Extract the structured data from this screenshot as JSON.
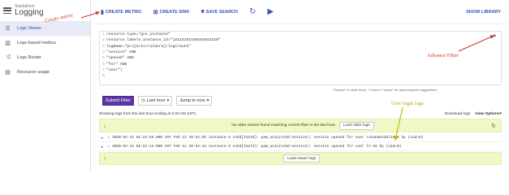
{
  "sidebar": {
    "brand_sub": "Stackdriver",
    "brand_title": "Logging",
    "items": [
      {
        "label": "Logs Viewer",
        "icon": "list-icon",
        "active": true
      },
      {
        "label": "Logs-based metrics",
        "icon": "bar-chart-icon",
        "active": false
      },
      {
        "label": "Logs Router",
        "icon": "shuffle-icon",
        "active": false
      },
      {
        "label": "Resource usage",
        "icon": "storage-icon",
        "active": false
      }
    ]
  },
  "toolbar": {
    "create_metric": "CREATE METRIC",
    "create_sink": "CREATE SINK",
    "save_search": "SAVE SEARCH",
    "show_library": "SHOW LIBRARY"
  },
  "editor": {
    "lines": [
      {
        "n": "1",
        "text": "resource.type=\"gce_instance\""
      },
      {
        "n": "2",
        "text": "resource.labels.instance_id=\"12115152168152642220\""
      },
      {
        "n": "3",
        "text": "logName=\"projects/rutanraj/logs/auth\""
      },
      {
        "n": "4",
        "text": "\"session\" AND"
      },
      {
        "n": "5",
        "text": "\"opened\" AND"
      },
      {
        "n": "6",
        "text": "\"for\" AND"
      },
      {
        "n": "7",
        "text": "\"user\"|"
      },
      {
        "n": "8",
        "text": ""
      }
    ],
    "hint": "\"Escape\" to clear focus. \"Control + Space\" for autocomplete suggestions"
  },
  "filters": {
    "submit": "Submit Filter",
    "time": "Last hour",
    "jump": "Jump to now"
  },
  "logs_header": {
    "summary": "Showing logs from the last hour ending at 2:24 AM (IST)",
    "download": "Download logs",
    "view_options": "View Options"
  },
  "older_bar": {
    "message": "No older entries found matching current filter in the last hour.",
    "button": "Load older logs"
  },
  "log_rows": [
    "2020-02-13 02:21:55.000 IST Feb 12 20:51:55 instance-3 sshd[31234]: pam_unix(sshd:session): session opened for user rutanmondal1996 by (uid=0)",
    "2020-02-13 02:22:44.000 IST Feb 12 20:52:44 instance-3 sshd[31272]: pam_unix(sshd:session): session opened for user lt-62 by (uid=0)"
  ],
  "newer_bar": {
    "button": "Load newer logs"
  },
  "annotations": {
    "create_metric": "Create metric",
    "advance_filter": "Advance Filter",
    "user_login": "User login logs"
  },
  "colors": {
    "accent": "#3f51b5",
    "submit": "#5c35a6",
    "green_bar": "#f0f9c6",
    "annotation_red": "#d32f2f",
    "annotation_yellow": "#b8a600"
  }
}
